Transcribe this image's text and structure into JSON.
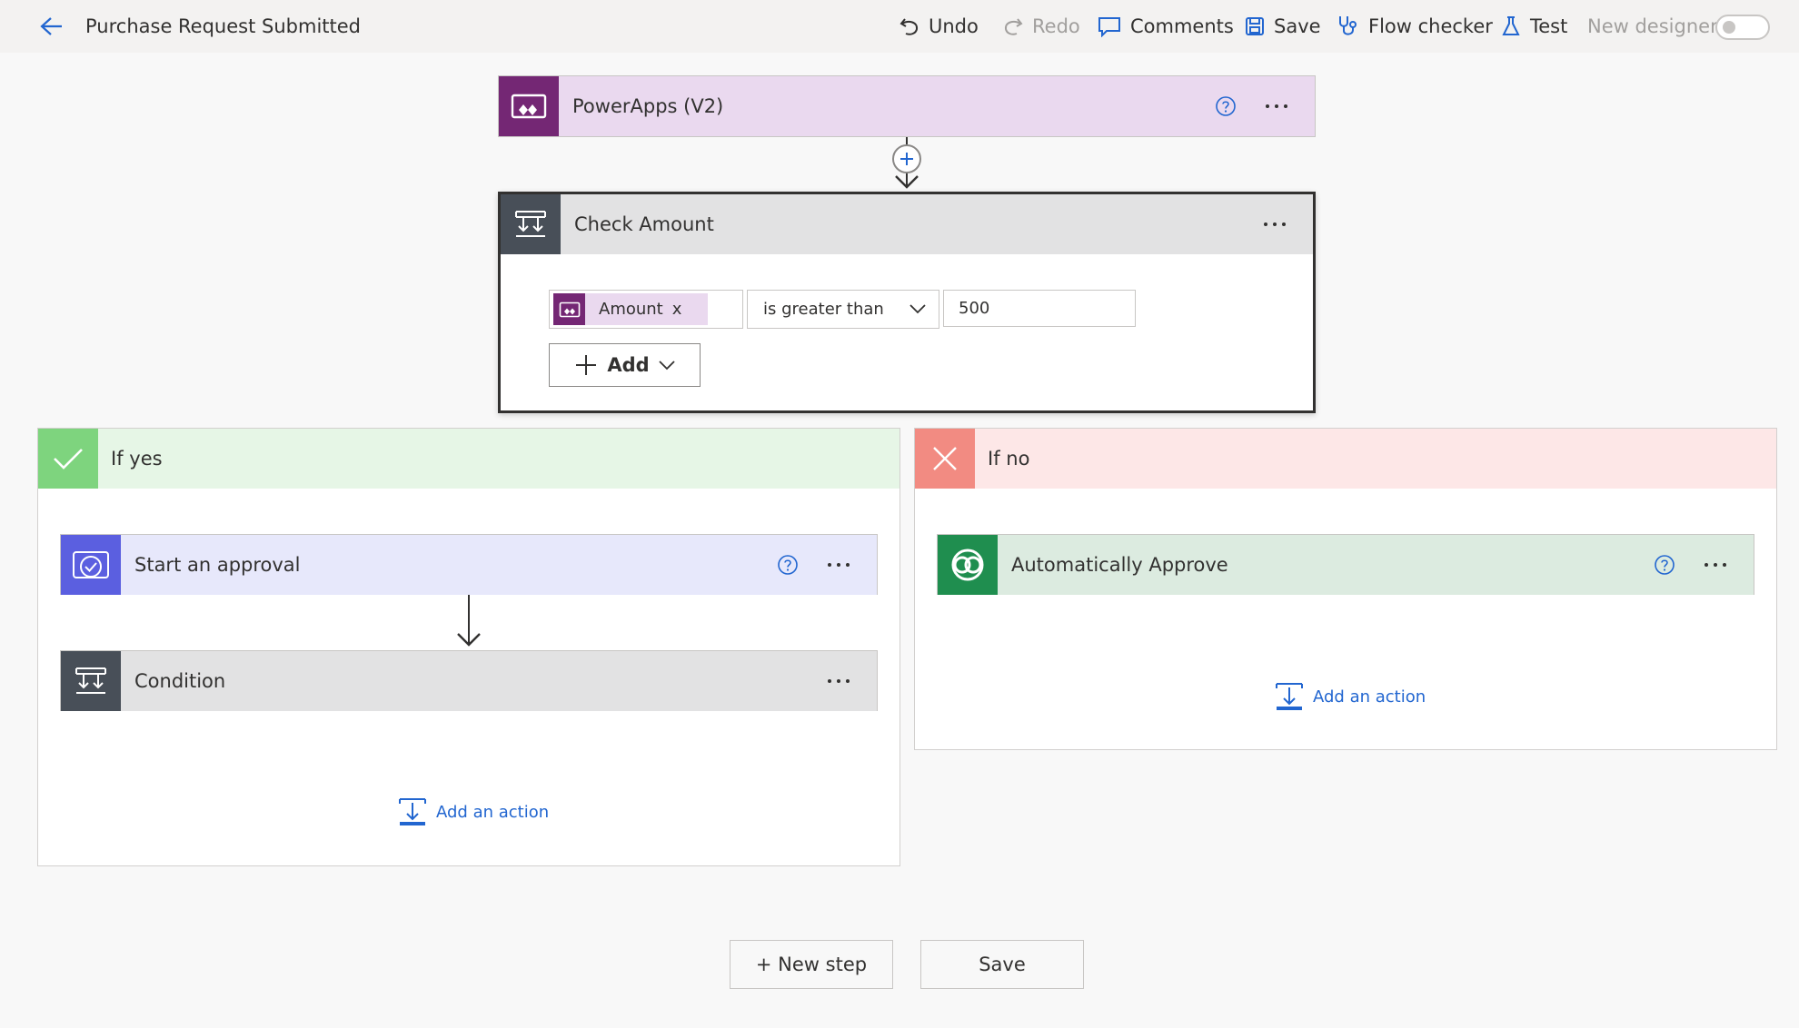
{
  "header": {
    "title": "Purchase Request Submitted",
    "undo": "Undo",
    "redo": "Redo",
    "comments": "Comments",
    "save": "Save",
    "flow_checker": "Flow checker",
    "test": "Test",
    "new_designer": "New designer"
  },
  "trigger": {
    "title": "PowerApps (V2)",
    "color": "#742774",
    "head_bg": "#ead9ef"
  },
  "condition": {
    "title": "Check Amount",
    "token_label": "Amount",
    "token_remove": "x",
    "operator": "is greater than",
    "value": "500",
    "add_label": "Add"
  },
  "branch_yes": {
    "label": "If yes",
    "color": "#7ed47e",
    "steps": [
      {
        "title": "Start an approval",
        "color": "#5b5fe0",
        "head_bg": "#e7e8fb"
      },
      {
        "title": "Condition",
        "color": "#484f58",
        "head_bg": "#e2e2e3"
      }
    ],
    "add_action": "Add an action"
  },
  "branch_no": {
    "label": "If no",
    "color": "#f28b82",
    "steps": [
      {
        "title": "Automatically Approve",
        "color": "#1f8e4f",
        "head_bg": "#dcebe0"
      }
    ],
    "add_action": "Add an action"
  },
  "footer": {
    "new_step": "+ New step",
    "save": "Save"
  }
}
